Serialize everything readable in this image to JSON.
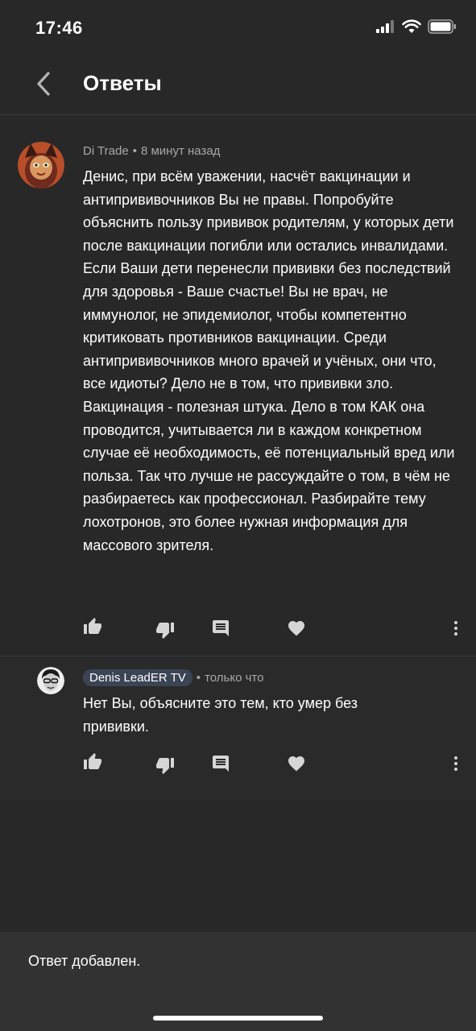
{
  "status_bar": {
    "time": "17:46",
    "battery_level": 1.0
  },
  "header": {
    "title": "Ответы",
    "back_icon": "chevron-left-icon"
  },
  "comments": [
    {
      "author": "Di Trade",
      "time": "8 минут назад",
      "text": "Денис, при всём уважении, насчёт вакцинации и антипрививочников Вы не правы. Попробуйте объяснить пользу прививок родителям, у которых дети после вакцинации погибли или остались инвалидами. Если Ваши дети перенесли прививки без последствий для здоровья - Ваше счастье! Вы не врач, не иммунолог, не эпидемиолог, чтобы компетентно критиковать противников вакцинации. Среди антипрививочников много врачей и учёных, они что, все идиоты? Дело не в том, что прививки зло. Вакцинация - полезная штука. Дело в том КАК она проводится, учитывается ли в каждом конкретном случае её необходимость, её потенциальный вред или польза. Так что лучше не рассуждайте о том, в чём не разбираетесь как профессионал. Разбирайте тему лохотронов, это более нужная информация для массового зрителя."
    },
    {
      "author": "Denis LeadER TV",
      "time": "только что",
      "text": "Нет Вы, объясните это тем, кто умер без прививки."
    }
  ],
  "actions": [
    "thumbs-up-icon",
    "thumbs-down-icon",
    "reply-icon",
    "heart-icon",
    "more-vert-icon"
  ],
  "snackbar": {
    "message": "Ответ добавлен."
  },
  "colors": {
    "background": "#282828",
    "text": "#ffffff",
    "meta": "#a8a8a8",
    "icon": "#d6d6d6",
    "author_badge": "#3b4455",
    "snackbar": "#323232"
  }
}
